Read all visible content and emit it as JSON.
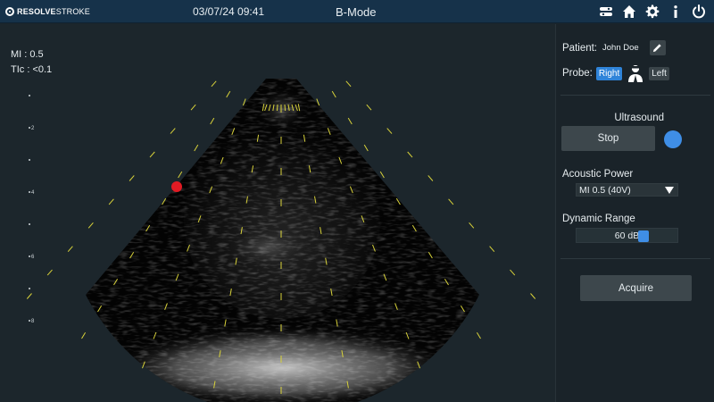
{
  "header": {
    "logo_bold": "RESOLVE",
    "logo_thin": "STROKE",
    "datetime": "03/07/24 09:41",
    "mode": "B-Mode",
    "icons": [
      "toggle-icon",
      "home-icon",
      "gear-icon",
      "info-icon",
      "power-icon"
    ]
  },
  "readouts": {
    "mi": "MI : 0.5",
    "tic": "TIc : <0.1"
  },
  "depth_scale": {
    "labels": [
      "",
      "2",
      "",
      "4",
      "",
      "6",
      "",
      "8"
    ]
  },
  "panel": {
    "patient_label": "Patient:",
    "patient_name": "John Doe",
    "probe_label": "Probe:",
    "probe_right": "Right",
    "probe_left": "Left",
    "probe_selected": "Right",
    "ultrasound_title": "Ultrasound",
    "stop_label": "Stop",
    "acoustic_power_label": "Acoustic Power",
    "acoustic_power_value": "MI 0.5 (40V)",
    "dynamic_range_label": "Dynamic Range",
    "dynamic_range_value": "60 dB",
    "dynamic_range_fraction": 0.68,
    "acquire_label": "Acquire"
  },
  "colors": {
    "header_bg": "#16324a",
    "accent_blue": "#3f8ee6",
    "marker_red": "#e01b24",
    "tick_yellow": "#d8d23a"
  }
}
